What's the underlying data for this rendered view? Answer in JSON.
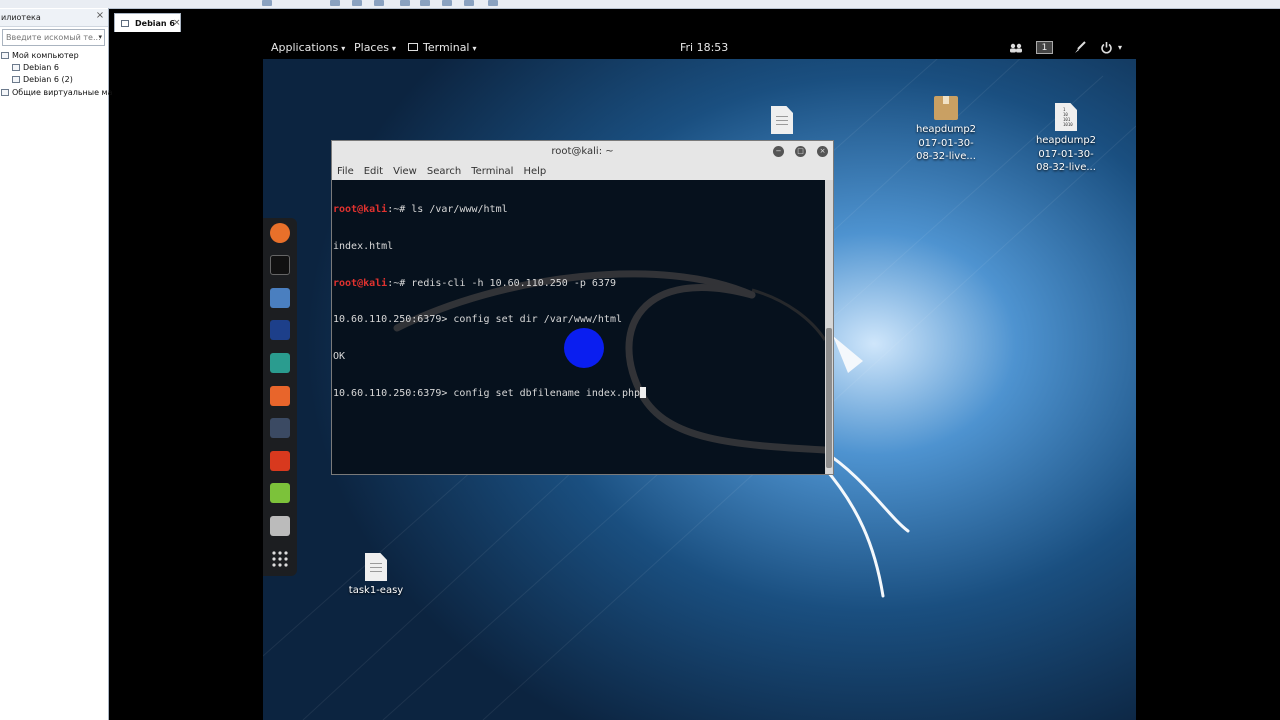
{
  "host": {
    "library_title": "илиотека",
    "search_placeholder": "Введите искомый те...",
    "tree": [
      {
        "label": "Мой компьютер"
      },
      {
        "label": "Debian 6"
      },
      {
        "label": "Debian 6 (2)"
      },
      {
        "label": "Общие виртуальные ма"
      }
    ],
    "tab_label": "Debian 6",
    "close_glyph": "×",
    "dropdown_glyph": "▾"
  },
  "guest": {
    "topbar": {
      "applications": "Applications",
      "places": "Places",
      "terminal": "Terminal",
      "clock": "Fri 18:53",
      "workspace": "1",
      "caret": "▾"
    },
    "dock": [
      {
        "name": "firefox-icon",
        "color": "#e8702a"
      },
      {
        "name": "terminal-icon",
        "color": "#111111"
      },
      {
        "name": "files-icon",
        "color": "#4a7fc0"
      },
      {
        "name": "metasploit-icon",
        "color": "#1d3f8a"
      },
      {
        "name": "armitage-icon",
        "color": "#2a9c8f"
      },
      {
        "name": "burpsuite-icon",
        "color": "#e8652b"
      },
      {
        "name": "maltego-icon",
        "color": "#3b4a63"
      },
      {
        "name": "faraday-icon",
        "color": "#d8391e"
      },
      {
        "name": "leafpad-icon",
        "color": "#7cc23a"
      },
      {
        "name": "cherrytree-icon",
        "color": "#bbbbbb"
      },
      {
        "name": "show-apps-icon",
        "color": "#dddddd"
      }
    ],
    "desktop_icons": {
      "doc_top": "",
      "heapdump1": [
        "heapdump2",
        "017-01-30-",
        "08-32-live..."
      ],
      "heapdump2": [
        "heapdump2",
        "017-01-30-",
        "08-32-live..."
      ],
      "task": "task1-easy"
    },
    "terminal": {
      "title": "root@kali: ~",
      "menu": [
        "File",
        "Edit",
        "View",
        "Search",
        "Terminal",
        "Help"
      ],
      "prompt_user": "root@kali",
      "prompt_path": ":~# ",
      "cmd1": "ls /var/www/html",
      "out1": "index.html",
      "cmd2": "redis-cli -h 10.60.110.250 -p 6379",
      "line3": "10.60.110.250:6379> config set dir /var/www/html",
      "out3": "OK",
      "line5": "10.60.110.250:6379> config set dbfilename index.php",
      "minimize": "−",
      "maximize": "□",
      "close": "×"
    }
  }
}
